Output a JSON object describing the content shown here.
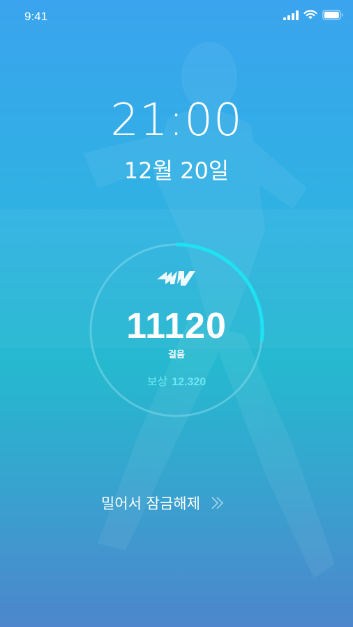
{
  "status_bar": {
    "time": "9:41",
    "icons": [
      "cellular-signal-icon",
      "wifi-icon",
      "battery-icon"
    ]
  },
  "lock_screen": {
    "clock": "21:00",
    "date": "12월 20일"
  },
  "pedometer": {
    "logo": "PW",
    "steps": "11120",
    "steps_unit": "걸음",
    "reward_label": "보상",
    "reward_value": "12.320",
    "progress": 0.27
  },
  "unlock": {
    "label": "밀어서 잠금해제",
    "icon": "double-chevron-right-icon"
  },
  "colors": {
    "accent": "#1ee2f2",
    "reward_text": "#6de8f4",
    "ring_track": "#7fd9ec"
  }
}
